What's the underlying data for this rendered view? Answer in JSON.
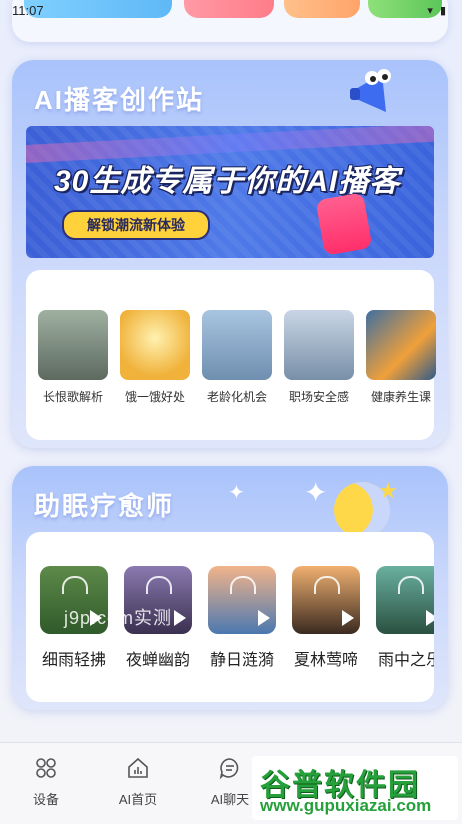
{
  "status_bar": {
    "time": "11:07"
  },
  "podcast_section": {
    "title": "AI播客创作站",
    "banner": {
      "headline": "30生成专属于你的AI播客",
      "button_label": "解锁潮流新体验"
    },
    "topics": [
      {
        "label": "长恨歌解析"
      },
      {
        "label": "饿一饿好处"
      },
      {
        "label": "老龄化机会"
      },
      {
        "label": "职场安全感"
      },
      {
        "label": "健康养生课"
      }
    ]
  },
  "sleep_section": {
    "title": "助眠疗愈师",
    "tracks": [
      {
        "label": "细雨轻拂"
      },
      {
        "label": "夜蝉幽韵"
      },
      {
        "label": "静日涟漪"
      },
      {
        "label": "夏林莺啼"
      },
      {
        "label": "雨中之乐"
      }
    ]
  },
  "watermark": "j9p.com实测",
  "bottom_nav": {
    "items": [
      {
        "label": "设备",
        "icon": "devices-grid-icon"
      },
      {
        "label": "AI首页",
        "icon": "home-chart-icon"
      },
      {
        "label": "AI聊天",
        "icon": "chat-bubble-icon"
      }
    ]
  },
  "overlay_logo": {
    "title": "谷普软件园",
    "url": "www.gupuxiazai.com"
  }
}
